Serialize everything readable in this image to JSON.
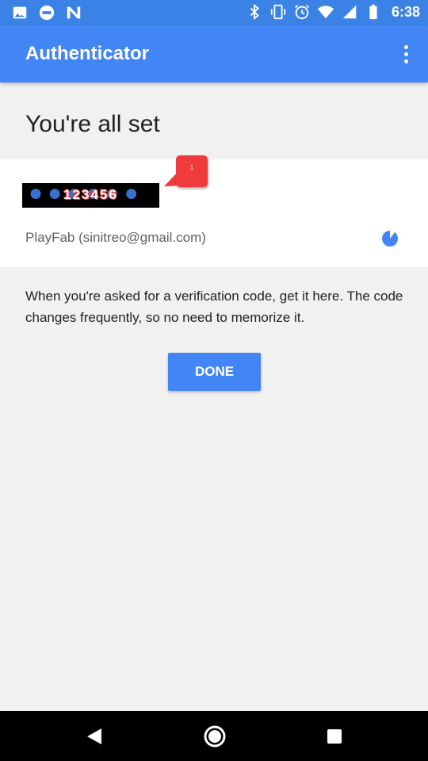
{
  "status_bar": {
    "time": "6:38",
    "left_icons": [
      "image-icon",
      "do-not-disturb-icon",
      "n-icon"
    ],
    "right_icons": [
      "bluetooth-icon",
      "vibrate-icon",
      "alarm-icon",
      "wifi-icon",
      "signal-icon",
      "battery-icon"
    ]
  },
  "app_bar": {
    "title": "Authenticator",
    "overflow_icon": "more-vert-icon"
  },
  "content": {
    "heading": "You're all set",
    "account": {
      "code": "123456",
      "badge": "1",
      "name": "PlayFab (sinitreo@gmail.com)",
      "timer_icon": "countdown-timer-icon"
    },
    "description": "When you're asked for a verification code, get it here. The code changes frequently, so no need to memorize it.",
    "done_label": "DONE"
  },
  "nav_bar": {
    "back_icon": "back-icon",
    "home_icon": "home-icon",
    "recents_icon": "recents-icon"
  },
  "colors": {
    "status_bar": "#3b82e6",
    "app_bar": "#4285f4",
    "accent": "#4285f4",
    "badge": "#ef3b3b",
    "background": "#f1f1f1"
  }
}
